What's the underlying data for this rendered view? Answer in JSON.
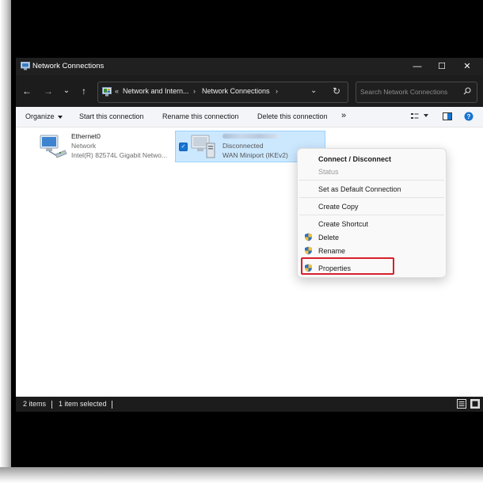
{
  "window": {
    "title": "Network Connections",
    "controls": {
      "minimize": "—",
      "maximize": "☐",
      "close": "✕"
    }
  },
  "nav": {
    "back": "←",
    "forward": "→",
    "recent": "⌄",
    "up": "↑",
    "breadcrumb": {
      "prefix": "«",
      "parent": "Network and Intern...",
      "separator": "›",
      "current": "Network Connections"
    },
    "dropdown": "⌄",
    "refresh": "↻",
    "search_placeholder": "Search Network Connections"
  },
  "commandbar": {
    "organize": "Organize",
    "start": "Start this connection",
    "rename": "Rename this connection",
    "delete": "Delete this connection",
    "more": "»"
  },
  "items": [
    {
      "name": "Ethernet0",
      "type": "Network",
      "device": "Intel(R) 82574L Gigabit Netwo...",
      "selected": false
    },
    {
      "name": "",
      "type": "Disconnected",
      "device": "WAN Miniport (IKEv2)",
      "selected": true
    }
  ],
  "statusbar": {
    "count": "2 items",
    "selected": "1 item selected"
  },
  "context_menu": {
    "items": [
      {
        "label": "Connect / Disconnect",
        "bold": true,
        "enabled": true,
        "shield": false
      },
      {
        "label": "Status",
        "bold": false,
        "enabled": false,
        "shield": false
      },
      {
        "label": "Set as Default Connection",
        "bold": false,
        "enabled": true,
        "shield": false
      },
      {
        "label": "Create Copy",
        "bold": false,
        "enabled": true,
        "shield": false
      },
      {
        "label": "Create Shortcut",
        "bold": false,
        "enabled": true,
        "shield": false
      },
      {
        "label": "Delete",
        "bold": false,
        "enabled": true,
        "shield": true
      },
      {
        "label": "Rename",
        "bold": false,
        "enabled": true,
        "shield": true
      },
      {
        "label": "Properties",
        "bold": false,
        "enabled": true,
        "shield": true,
        "highlighted": true
      }
    ]
  },
  "colors": {
    "titlebar": "#202020",
    "selection": "#cce8ff",
    "highlight_box": "#d81f2b",
    "accent": "#1873d0"
  }
}
